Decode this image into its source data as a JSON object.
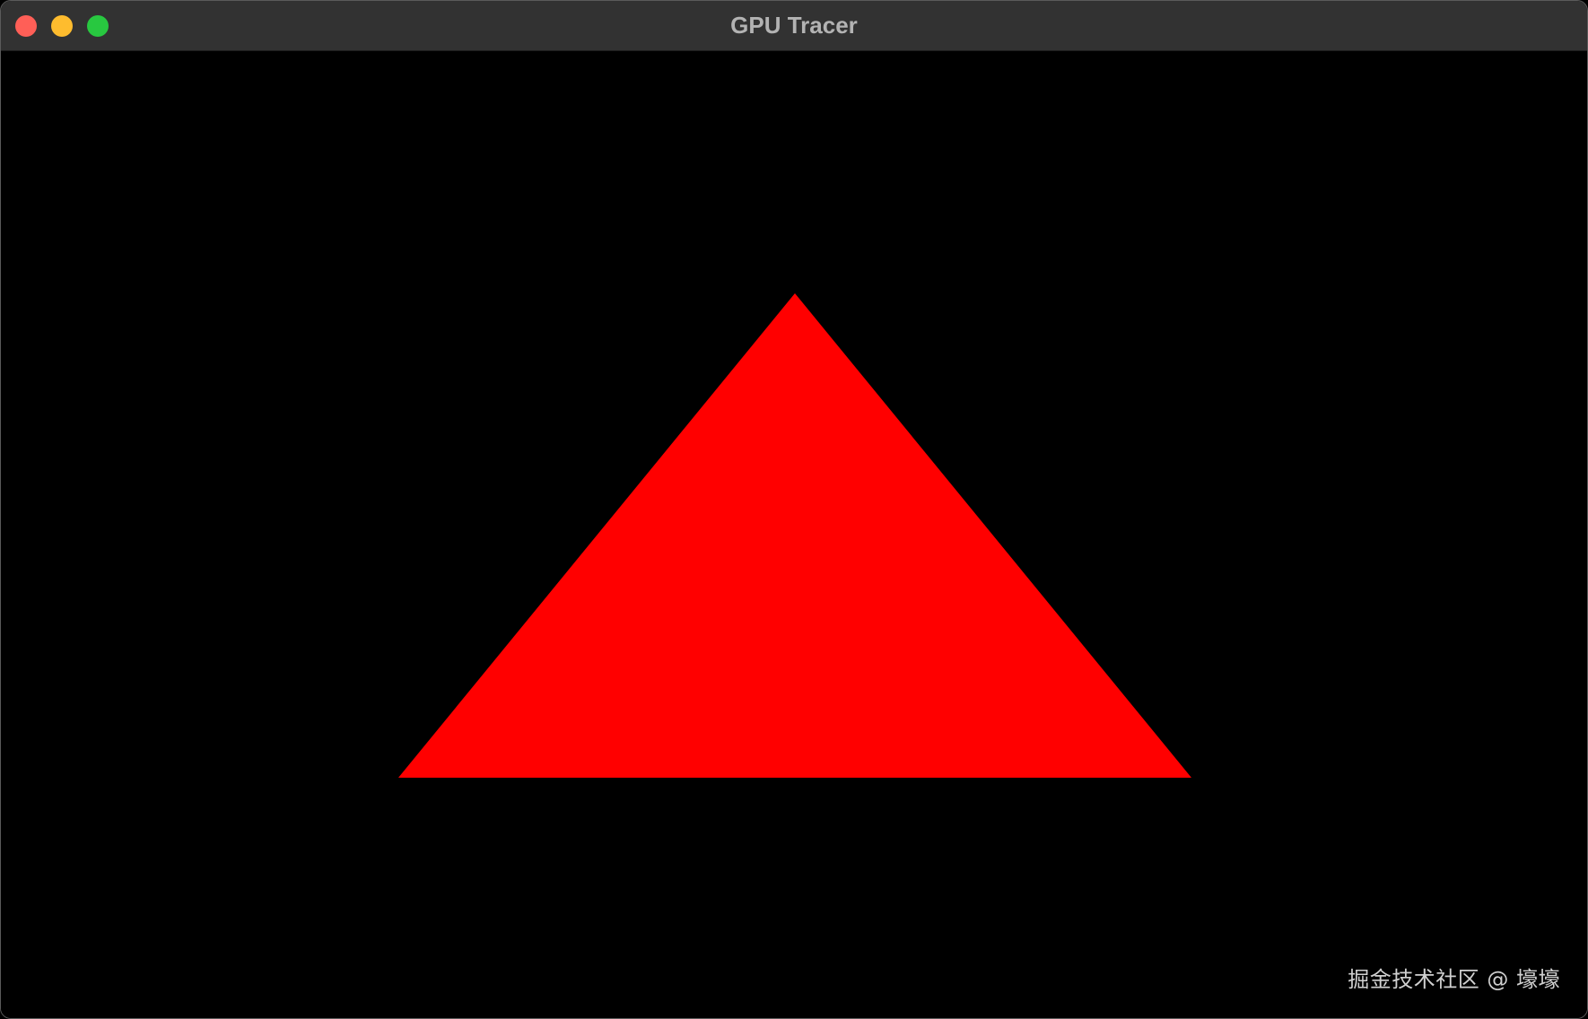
{
  "window": {
    "title": "GPU Tracer",
    "controls": {
      "close_color": "#ff5f57",
      "minimize_color": "#febc2e",
      "zoom_color": "#28c840"
    }
  },
  "canvas": {
    "background": "#000000",
    "triangle_color": "#ff0000"
  },
  "watermark": "掘金技术社区 @ 壕壕"
}
